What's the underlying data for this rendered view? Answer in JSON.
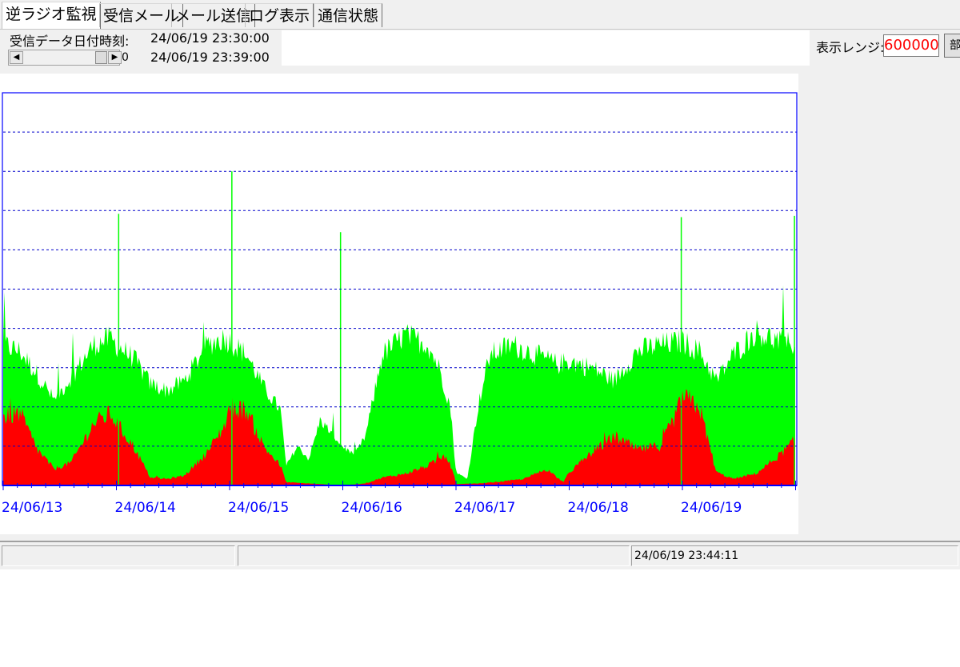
{
  "tabs": [
    {
      "label": "逆ラジオ監視",
      "active": true
    },
    {
      "label": "受信メール",
      "active": false
    },
    {
      "label": "メール送信",
      "active": false
    },
    {
      "label": "ログ表示",
      "active": false
    },
    {
      "label": "通信状態",
      "active": false
    }
  ],
  "info": {
    "datetime_label": "受信データ日付時刻:",
    "datetime_value": "24/06/19 23:30:00",
    "second_datetime": "24/06/19 23:39:00",
    "scroll_value": "0"
  },
  "range": {
    "label": "表示レンジ:",
    "value": "600000"
  },
  "side_button_label": "部",
  "status": {
    "pane3": "24/06/19 23:44:11"
  },
  "colors": {
    "total": "#00ff00",
    "part": "#ff0000",
    "axis": "#0000ff",
    "grid": "#0000cc"
  },
  "chart_data": {
    "type": "area",
    "x_tick_labels": [
      "24/06/13",
      "24/06/14",
      "24/06/15",
      "24/06/16",
      "24/06/17",
      "24/06/18",
      "24/06/19"
    ],
    "y_range": [
      0,
      600000
    ],
    "y_gridlines": [
      60000,
      120000,
      180000,
      240000,
      300000,
      360000,
      420000,
      480000,
      540000
    ],
    "grid": "dashed horizontal",
    "series": [
      {
        "color": "#00ff00",
        "daily_points": [
          [
            0,
            215000
          ],
          [
            0.15,
            205000
          ],
          [
            0.3,
            170000
          ],
          [
            0.45,
            130000
          ],
          [
            0.6,
            165000
          ],
          [
            0.8,
            215000
          ],
          [
            0.95,
            225000
          ],
          [
            1.0,
            215000
          ],
          [
            1.15,
            195000
          ],
          [
            1.3,
            155000
          ],
          [
            1.45,
            145000
          ],
          [
            1.6,
            160000
          ],
          [
            1.8,
            215000
          ],
          [
            1.95,
            225000
          ],
          [
            2.0,
            220000
          ],
          [
            2.15,
            200000
          ],
          [
            2.3,
            150000
          ],
          [
            2.45,
            115000
          ],
          [
            2.5,
            30000
          ],
          [
            2.6,
            60000
          ],
          [
            2.7,
            40000
          ],
          [
            2.8,
            100000
          ],
          [
            2.9,
            80000
          ],
          [
            3.0,
            60000
          ],
          [
            3.1,
            45000
          ],
          [
            3.2,
            75000
          ],
          [
            3.35,
            200000
          ],
          [
            3.55,
            230000
          ],
          [
            3.75,
            215000
          ],
          [
            3.85,
            180000
          ],
          [
            3.95,
            120000
          ],
          [
            4.0,
            20000
          ],
          [
            4.1,
            10000
          ],
          [
            4.2,
            125000
          ],
          [
            4.3,
            200000
          ],
          [
            4.5,
            215000
          ],
          [
            4.7,
            200000
          ],
          [
            4.9,
            185000
          ],
          [
            5.0,
            190000
          ],
          [
            5.2,
            180000
          ],
          [
            5.4,
            160000
          ],
          [
            5.6,
            205000
          ],
          [
            5.8,
            215000
          ],
          [
            6.0,
            220000
          ],
          [
            6.15,
            205000
          ],
          [
            6.3,
            160000
          ],
          [
            6.45,
            200000
          ],
          [
            6.65,
            235000
          ],
          [
            6.85,
            220000
          ],
          [
            7.0,
            215000
          ]
        ]
      },
      {
        "color": "#ff0000",
        "daily_points": [
          [
            0,
            105000
          ],
          [
            0.15,
            110000
          ],
          [
            0.3,
            55000
          ],
          [
            0.45,
            25000
          ],
          [
            0.6,
            35000
          ],
          [
            0.8,
            95000
          ],
          [
            0.95,
            110000
          ],
          [
            1.0,
            95000
          ],
          [
            1.15,
            60000
          ],
          [
            1.3,
            12000
          ],
          [
            1.45,
            10000
          ],
          [
            1.6,
            15000
          ],
          [
            1.8,
            50000
          ],
          [
            1.95,
            90000
          ],
          [
            2.0,
            120000
          ],
          [
            2.15,
            115000
          ],
          [
            2.3,
            60000
          ],
          [
            2.45,
            30000
          ],
          [
            2.5,
            5000
          ],
          [
            2.8,
            2000
          ],
          [
            3.0,
            0
          ],
          [
            3.2,
            3000
          ],
          [
            3.35,
            12000
          ],
          [
            3.55,
            18000
          ],
          [
            3.75,
            30000
          ],
          [
            3.9,
            45000
          ],
          [
            3.97,
            25000
          ],
          [
            4.0,
            2000
          ],
          [
            4.2,
            3000
          ],
          [
            4.4,
            6000
          ],
          [
            4.6,
            10000
          ],
          [
            4.8,
            25000
          ],
          [
            4.95,
            5000
          ],
          [
            5.0,
            20000
          ],
          [
            5.2,
            50000
          ],
          [
            5.4,
            75000
          ],
          [
            5.6,
            55000
          ],
          [
            5.8,
            60000
          ],
          [
            5.95,
            110000
          ],
          [
            6.0,
            135000
          ],
          [
            6.15,
            120000
          ],
          [
            6.3,
            20000
          ],
          [
            6.45,
            10000
          ],
          [
            6.65,
            18000
          ],
          [
            6.85,
            45000
          ],
          [
            7.0,
            70000
          ]
        ]
      }
    ]
  }
}
